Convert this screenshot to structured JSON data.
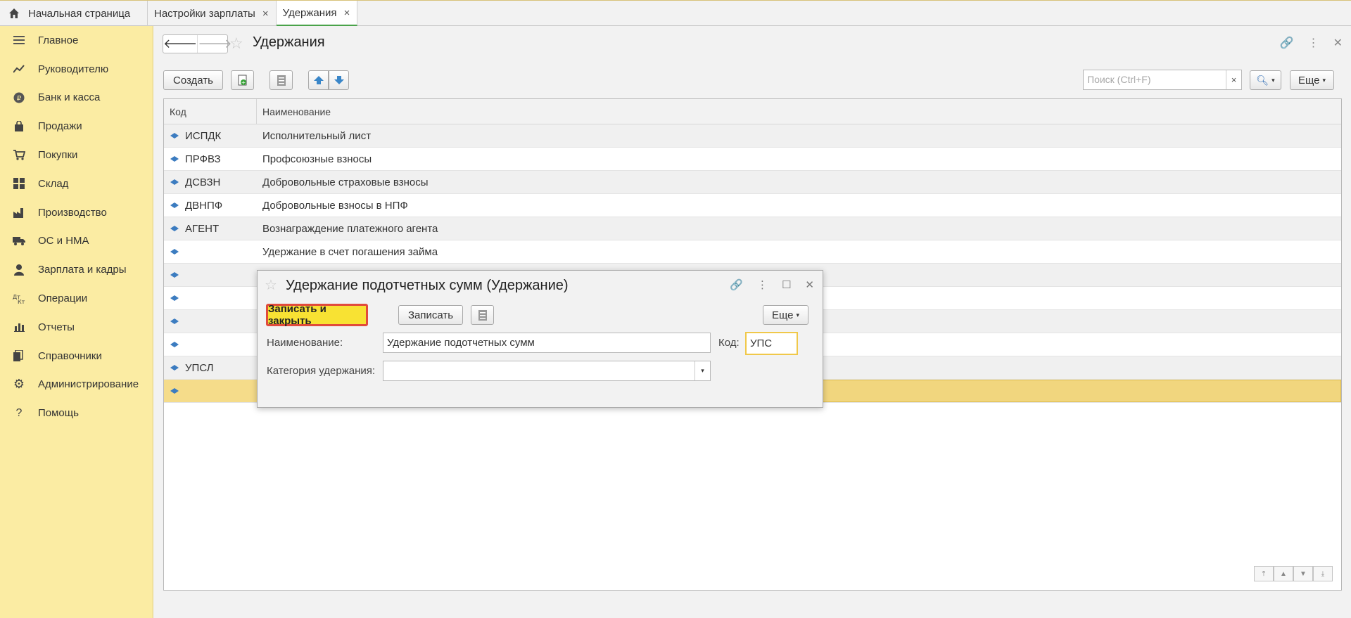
{
  "tabs": {
    "home": "Начальная страница",
    "items": [
      {
        "label": "Настройки зарплаты",
        "close": "×"
      },
      {
        "label": "Удержания",
        "close": "×"
      }
    ]
  },
  "sidebar": {
    "items": [
      {
        "label": "Главное",
        "icon": "menu-icon"
      },
      {
        "label": "Руководителю",
        "icon": "trend-icon"
      },
      {
        "label": "Банк и касса",
        "icon": "ruble-icon"
      },
      {
        "label": "Продажи",
        "icon": "bag-icon"
      },
      {
        "label": "Покупки",
        "icon": "cart-icon"
      },
      {
        "label": "Склад",
        "icon": "warehouse-icon"
      },
      {
        "label": "Производство",
        "icon": "factory-icon"
      },
      {
        "label": "ОС и НМА",
        "icon": "truck-icon"
      },
      {
        "label": "Зарплата и кадры",
        "icon": "person-icon"
      },
      {
        "label": "Операции",
        "icon": "dt-kt-icon"
      },
      {
        "label": "Отчеты",
        "icon": "bar-chart-icon"
      },
      {
        "label": "Справочники",
        "icon": "books-icon"
      },
      {
        "label": "Администрирование",
        "icon": "gear-icon"
      },
      {
        "label": "Помощь",
        "icon": "question-icon"
      }
    ]
  },
  "form": {
    "title": "Удержания",
    "create_label": "Создать",
    "search_placeholder": "Поиск (Ctrl+F)",
    "search_clear": "×",
    "more_label": "Еще",
    "columns": {
      "code": "Код",
      "name": "Наименование"
    },
    "rows": [
      {
        "code": "ИСПДК",
        "name": "Исполнительный лист"
      },
      {
        "code": "ПРФВЗ",
        "name": "Профсоюзные взносы"
      },
      {
        "code": "ДСВЗН",
        "name": "Добровольные страховые взносы"
      },
      {
        "code": "ДВНПФ",
        "name": "Добровольные взносы в НПФ"
      },
      {
        "code": "АГЕНТ",
        "name": "Вознаграждение платежного агента"
      },
      {
        "code": "",
        "name": "Удержание в счет погашения займа"
      },
      {
        "code": "",
        "name": ""
      },
      {
        "code": "",
        "name": ""
      },
      {
        "code": "",
        "name": ""
      },
      {
        "code": "",
        "name": ""
      },
      {
        "code": "УПСЛ",
        "name": ""
      },
      {
        "code": "",
        "name": ""
      }
    ]
  },
  "dialog": {
    "title": "Удержание подотчетных сумм (Удержание)",
    "save_close_label": "Записать и закрыть",
    "save_label": "Записать",
    "more_label": "Еще",
    "name_label": "Наименование:",
    "name_value": "Удержание подотчетных сумм",
    "code_label": "Код:",
    "code_value": "УПС",
    "category_label": "Категория удержания:",
    "category_value": ""
  },
  "colors": {
    "sidebar": "#fbeca3",
    "primary": "#f8e233",
    "selection": "#f5dc8a",
    "accent_border": "#e14b3b"
  }
}
